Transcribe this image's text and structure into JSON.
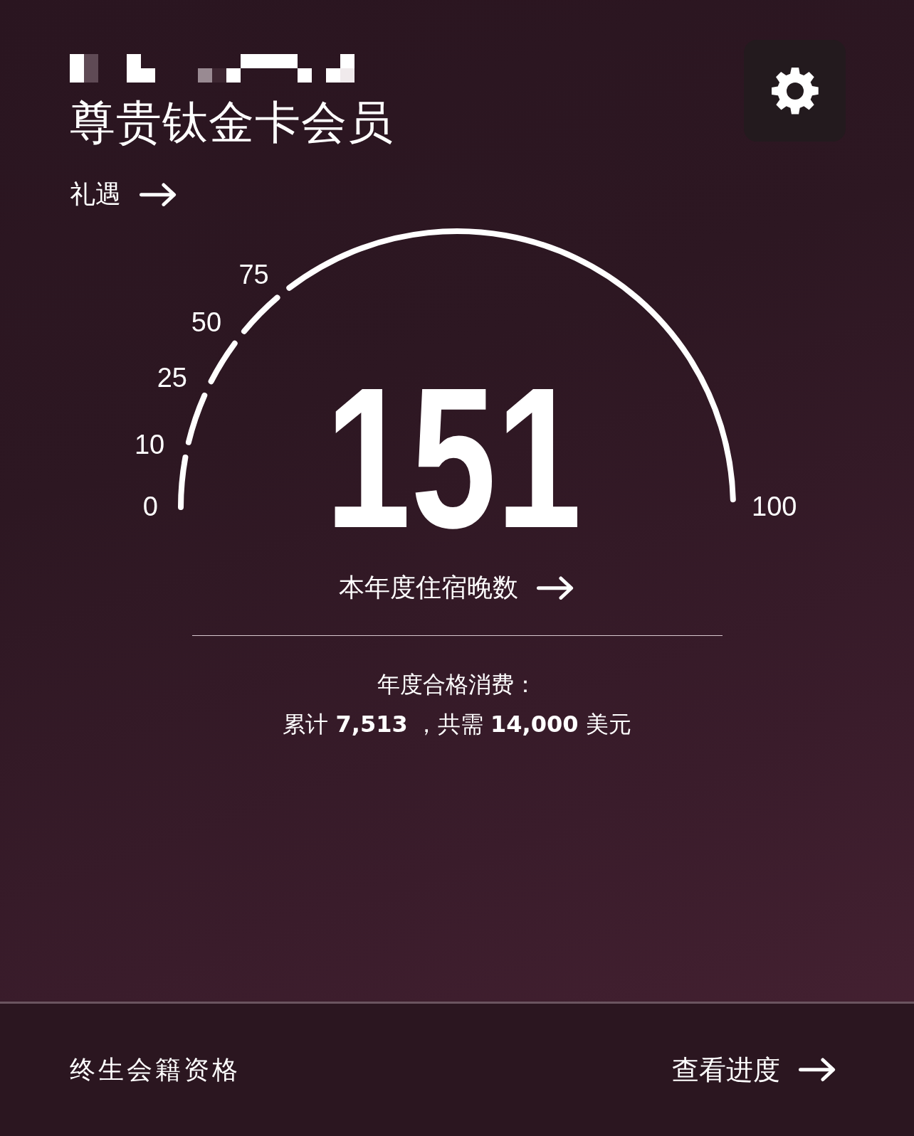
{
  "tier": "尊贵钛金卡会员",
  "benefits_link": "礼遇",
  "gauge": {
    "ticks": [
      "0",
      "10",
      "25",
      "50",
      "75"
    ],
    "max_label": "100",
    "value": "151"
  },
  "nights_link": "本年度住宿晚数",
  "spending": {
    "label": "年度合格消费：",
    "summary": "累计 **7,513** ，共需 **14,000** 美元"
  },
  "footer": {
    "title": "终生会籍资格",
    "link": "查看进度"
  }
}
